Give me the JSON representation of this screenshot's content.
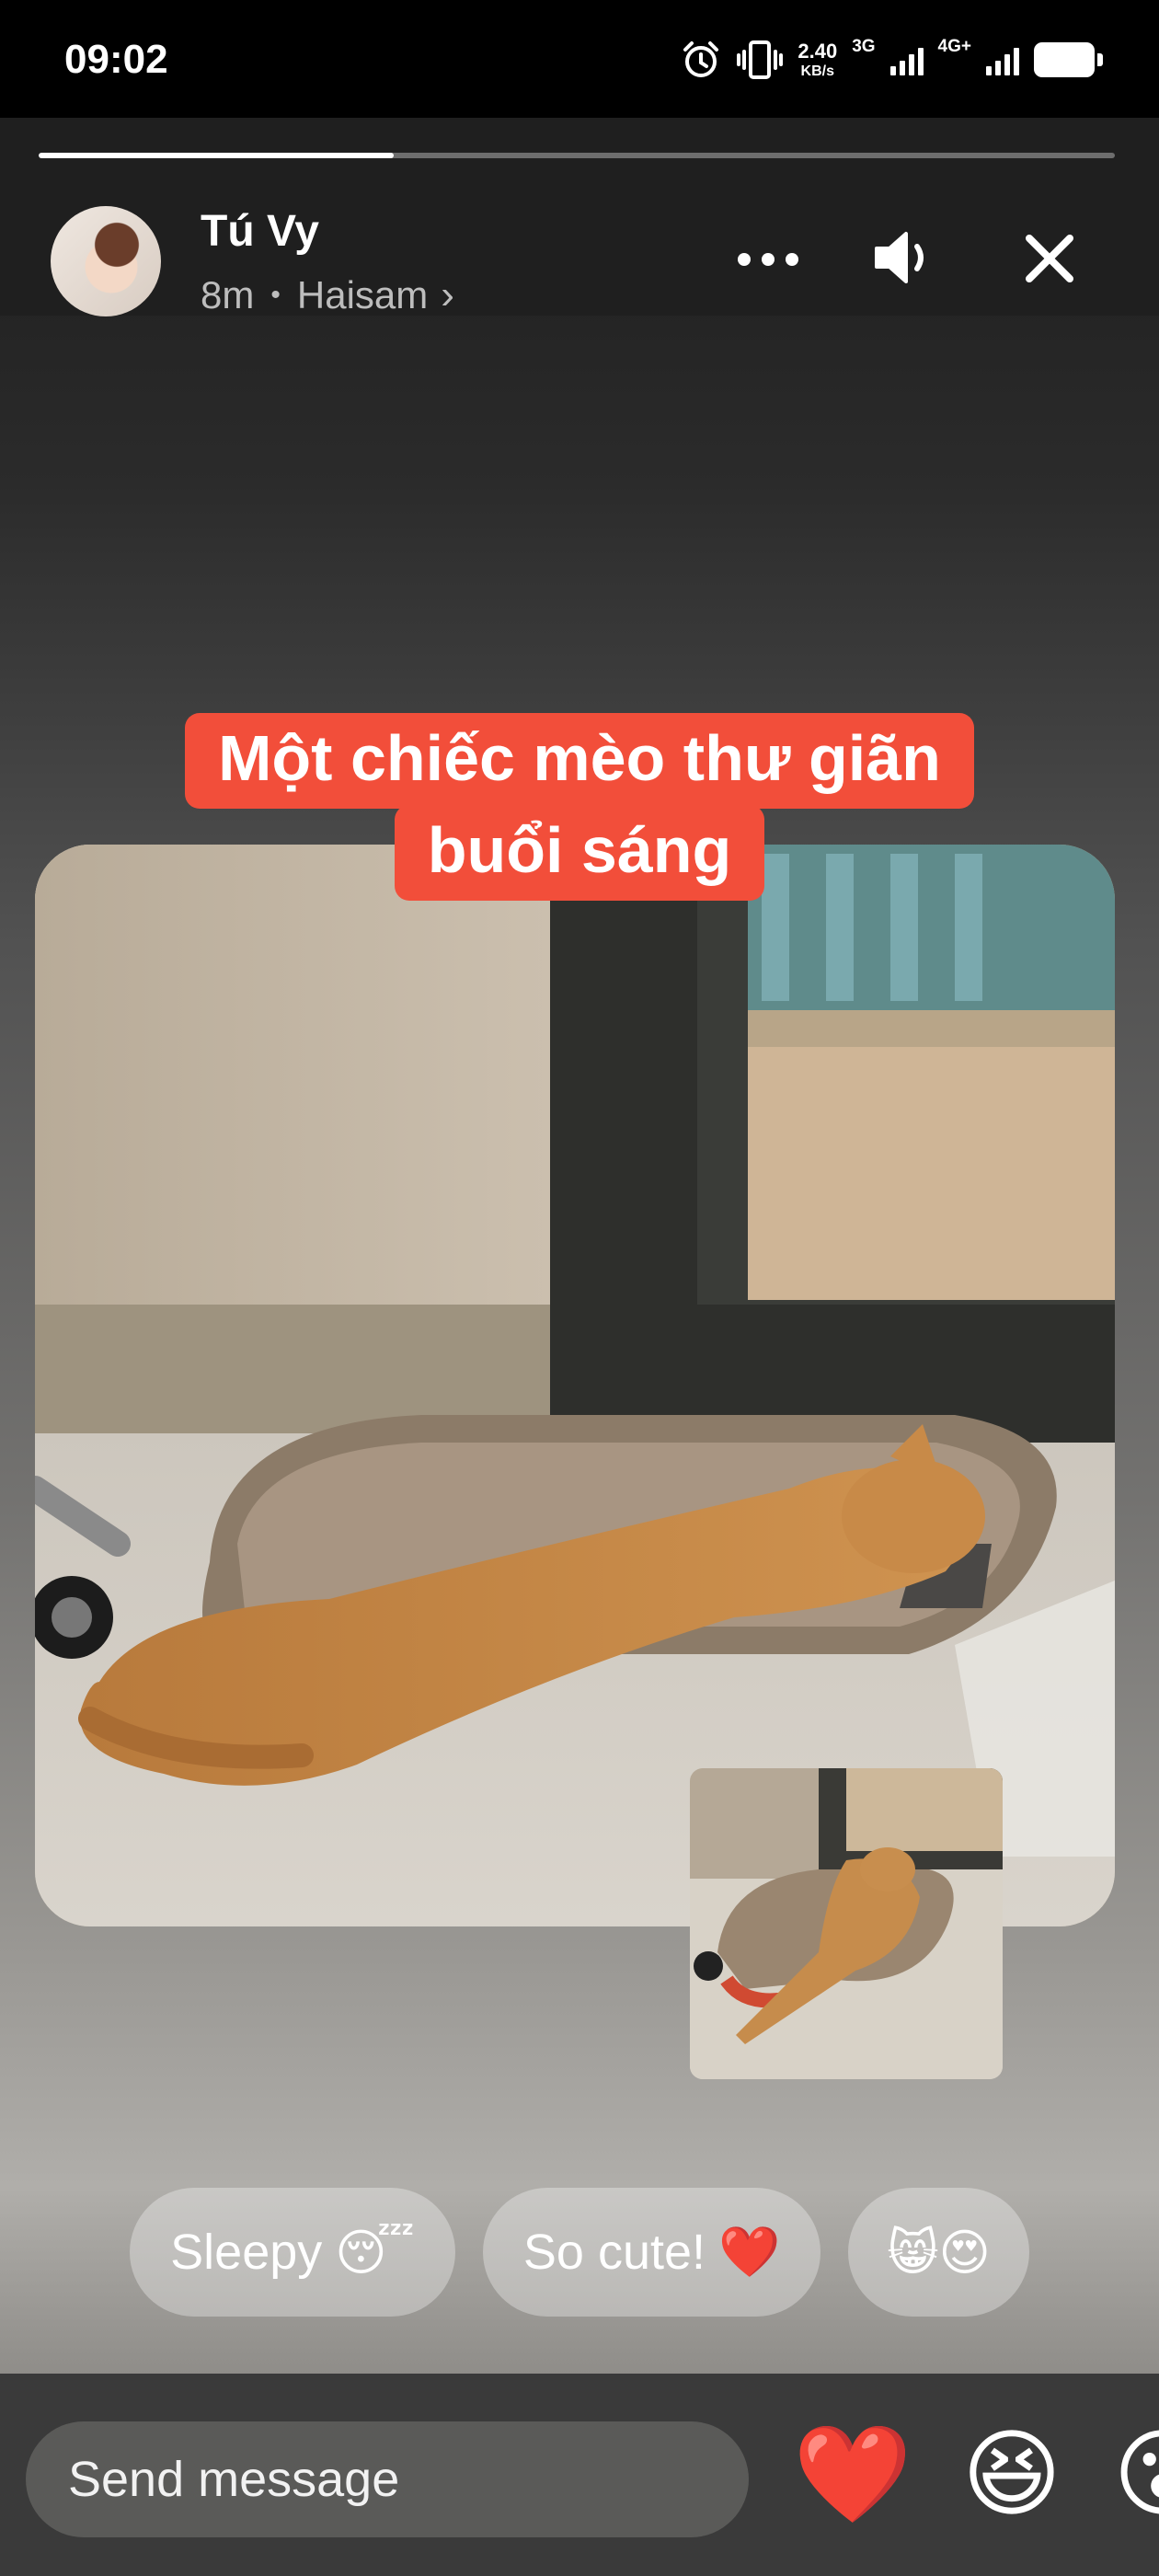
{
  "status_bar": {
    "time": "09:02",
    "net_speed_value": "2.40",
    "net_speed_unit": "KB/s",
    "net_type_1": "3G",
    "net_type_2": "4G+"
  },
  "story": {
    "progress": 0.33,
    "user_name": "Tú Vy",
    "time_ago": "8m",
    "dot": "•",
    "music_label": "Haisam",
    "chevron": "›",
    "caption_line1": "Một chiếc mèo thư giãn",
    "caption_line2": "buổi sáng"
  },
  "quick_replies": [
    {
      "label": "Sleepy",
      "emoji": "😴"
    },
    {
      "label": "So cute!",
      "emoji": "❤️"
    },
    {
      "label": "",
      "emoji": "😸😍"
    }
  ],
  "footer": {
    "message_placeholder": "Send message",
    "reaction_1": "❤️",
    "reaction_2": "😆",
    "reaction_3": "😮"
  },
  "colors": {
    "caption_bg": "#f24e3a",
    "progress_fill": "#ffffff"
  }
}
